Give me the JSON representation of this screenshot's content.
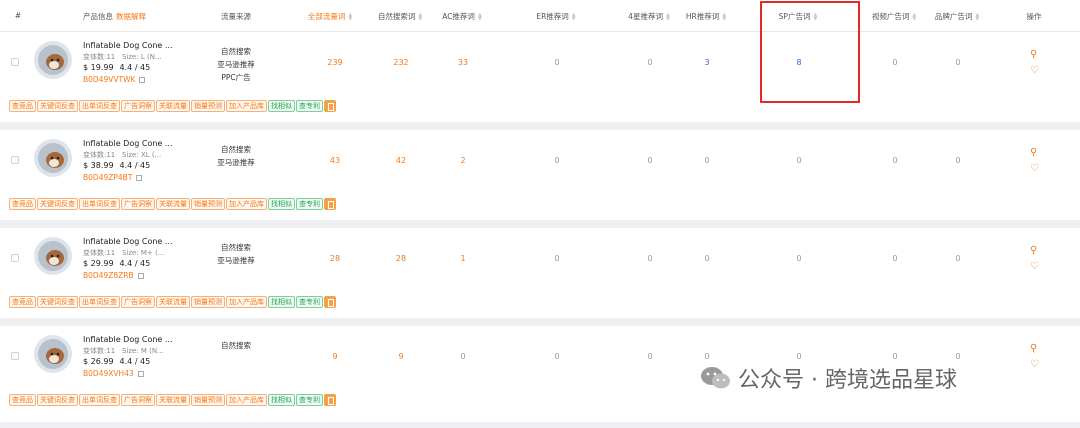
{
  "header": {
    "index": "#",
    "product_info": "产品信息",
    "data_explain": "数据解释",
    "traffic_source": "流量来源",
    "all_keywords": "全部流量词",
    "natural_search": "自然搜索词",
    "ac_words": "AC推荐词",
    "er_words": "ER推荐词",
    "star4_words": "4星推荐词",
    "hr_words": "HR推荐词",
    "sp_ad_words": "SP广告词",
    "video_ad_words": "视频广告词",
    "brand_ad_words": "品牌广告词",
    "actions": "操作"
  },
  "tags": [
    "查竞品",
    "关键词反查",
    "出单词反查",
    "广告洞察",
    "关联流量",
    "销量预测",
    "加入产品库",
    "找相似",
    "查专利"
  ],
  "rows": [
    {
      "title": "Inflatable Dog Cone ...",
      "variants": "变体数:11",
      "size": "Size: L (N...",
      "price": "$ 19.99",
      "rating": "4.4 / 45",
      "asin": "B0D49VVTWK",
      "sources": [
        "自然搜索",
        "亚马逊推荐",
        "PPC广告"
      ],
      "all": "239",
      "natural": "232",
      "ac": "33",
      "er": "0",
      "star4": "0",
      "hr": "3",
      "sp": "8",
      "video": "0",
      "brand": "0"
    },
    {
      "title": "Inflatable Dog Cone ...",
      "variants": "变体数:11",
      "size": "Size: XL (...",
      "price": "$ 38.99",
      "rating": "4.4 / 45",
      "asin": "B0D49ZP4BT",
      "sources": [
        "自然搜索",
        "亚马逊推荐"
      ],
      "all": "43",
      "natural": "42",
      "ac": "2",
      "er": "0",
      "star4": "0",
      "hr": "0",
      "sp": "0",
      "video": "0",
      "brand": "0"
    },
    {
      "title": "Inflatable Dog Cone ...",
      "variants": "变体数:11",
      "size": "Size: M+ (...",
      "price": "$ 29.99",
      "rating": "4.4 / 45",
      "asin": "B0D49Z8ZRB",
      "sources": [
        "自然搜索",
        "亚马逊推荐"
      ],
      "all": "28",
      "natural": "28",
      "ac": "1",
      "er": "0",
      "star4": "0",
      "hr": "0",
      "sp": "0",
      "video": "0",
      "brand": "0"
    },
    {
      "title": "Inflatable Dog Cone ...",
      "variants": "变体数:11",
      "size": "Size: M (N...",
      "price": "$ 26.99",
      "rating": "4.4 / 45",
      "asin": "B0D49XVH43",
      "sources": [
        "自然搜索"
      ],
      "all": "9",
      "natural": "9",
      "ac": "0",
      "er": "0",
      "star4": "0",
      "hr": "0",
      "sp": "0",
      "video": "0",
      "brand": "0"
    }
  ],
  "watermark": {
    "text": "公众号 · 跨境选品星球",
    "icon": "wechat-icon"
  },
  "colors": {
    "accent": "#f07a1a",
    "link_blue": "#3a6bd8",
    "highlight": "#e32828",
    "tag_green": "#27a35a"
  }
}
